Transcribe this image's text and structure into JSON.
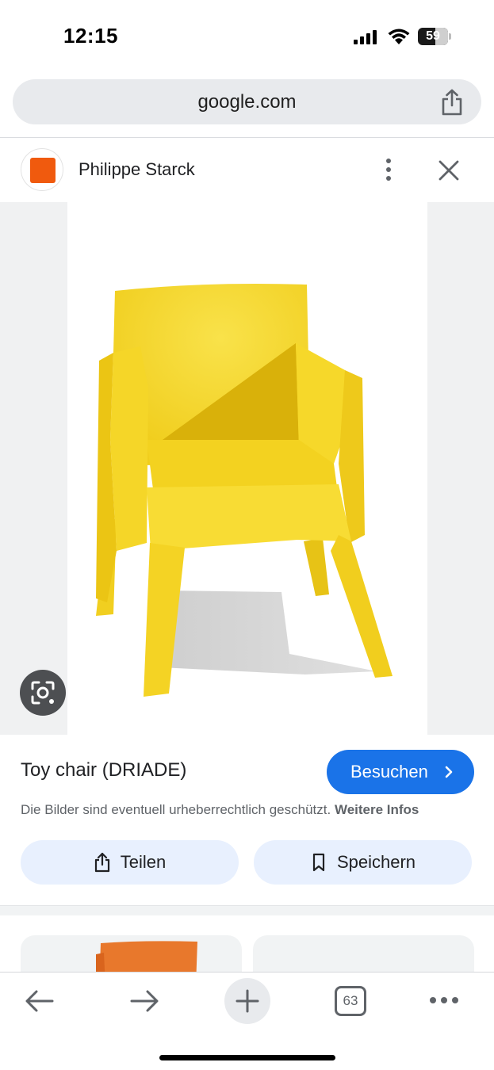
{
  "status_bar": {
    "time": "12:15",
    "battery_level": "59",
    "battery_fraction": 0.59
  },
  "address_bar": {
    "url": "google.com"
  },
  "source": {
    "name": "Philippe Starck",
    "favicon_color": "#f05a0e"
  },
  "image": {
    "subject_color": "#f5d320",
    "background_color": "#f0f1f2"
  },
  "result": {
    "title": "Toy chair (DRIADE)",
    "visit_label": "Besuchen",
    "copyright_text": "Die Bilder sind eventuell urheberrechtlich geschützt.",
    "copyright_link": "Weitere Infos",
    "share_label": "Teilen",
    "save_label": "Speichern"
  },
  "toolbar": {
    "tab_count": "63"
  },
  "colors": {
    "accent": "#1a73e8",
    "chip_background": "#e8f0fe",
    "icon_gray": "#5f6368"
  },
  "icons": [
    "signal-icon",
    "wifi-icon",
    "battery-icon",
    "share-icon",
    "more-vert-icon",
    "close-icon",
    "lens-icon",
    "chevron-right-icon",
    "bookmark-icon",
    "back-arrow-icon",
    "forward-arrow-icon",
    "plus-icon",
    "tabs-icon",
    "more-horiz-icon"
  ]
}
